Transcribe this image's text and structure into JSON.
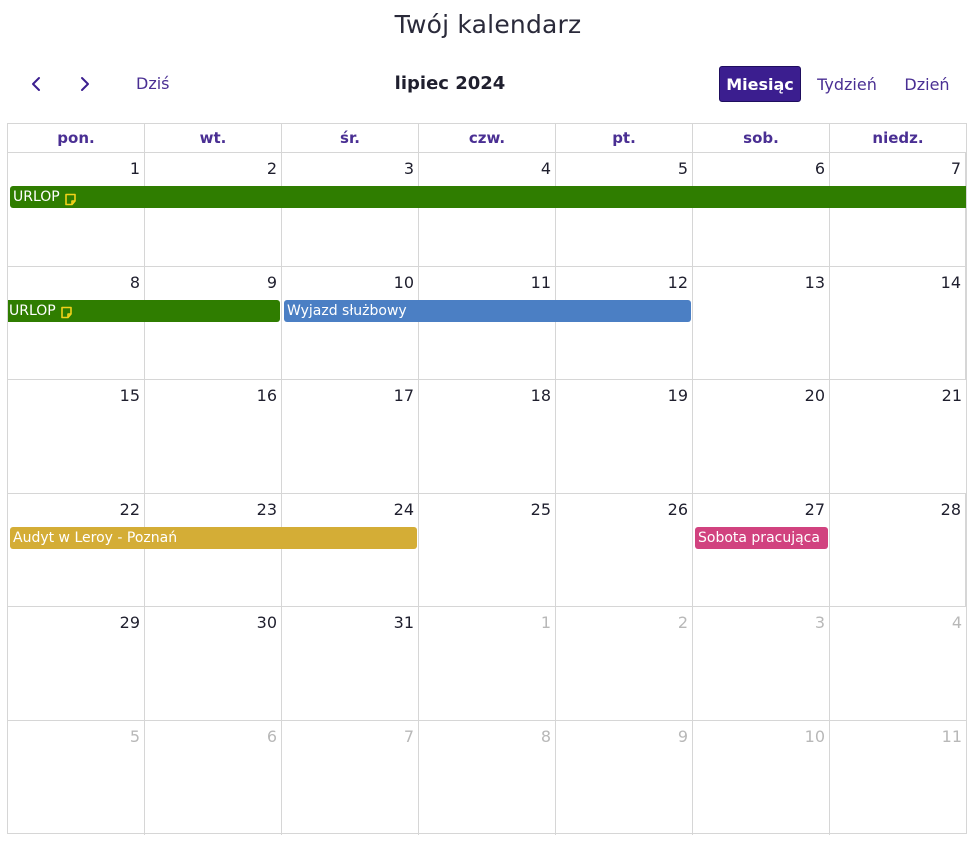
{
  "page": {
    "title": "Twój kalendarz"
  },
  "toolbar": {
    "today_label": "Dziś",
    "period_label": "lipiec 2024",
    "views": {
      "month": "Miesiąc",
      "week": "Tydzień",
      "day": "Dzień"
    },
    "active_view": "month"
  },
  "weekdays": [
    "pon.",
    "wt.",
    "śr.",
    "czw.",
    "pt.",
    "sob.",
    "niedz."
  ],
  "weeks": [
    [
      {
        "n": "1"
      },
      {
        "n": "2"
      },
      {
        "n": "3"
      },
      {
        "n": "4"
      },
      {
        "n": "5"
      },
      {
        "n": "6"
      },
      {
        "n": "7"
      }
    ],
    [
      {
        "n": "8"
      },
      {
        "n": "9"
      },
      {
        "n": "10"
      },
      {
        "n": "11"
      },
      {
        "n": "12"
      },
      {
        "n": "13"
      },
      {
        "n": "14"
      }
    ],
    [
      {
        "n": "15"
      },
      {
        "n": "16"
      },
      {
        "n": "17"
      },
      {
        "n": "18"
      },
      {
        "n": "19"
      },
      {
        "n": "20"
      },
      {
        "n": "21"
      }
    ],
    [
      {
        "n": "22"
      },
      {
        "n": "23"
      },
      {
        "n": "24"
      },
      {
        "n": "25"
      },
      {
        "n": "26"
      },
      {
        "n": "27"
      },
      {
        "n": "28"
      }
    ],
    [
      {
        "n": "29"
      },
      {
        "n": "30"
      },
      {
        "n": "31"
      },
      {
        "n": "1",
        "other": true
      },
      {
        "n": "2",
        "other": true
      },
      {
        "n": "3",
        "other": true
      },
      {
        "n": "4",
        "other": true
      }
    ],
    [
      {
        "n": "5",
        "other": true
      },
      {
        "n": "6",
        "other": true
      },
      {
        "n": "7",
        "other": true
      },
      {
        "n": "8",
        "other": true
      },
      {
        "n": "9",
        "other": true
      },
      {
        "n": "10",
        "other": true
      },
      {
        "n": "11",
        "other": true
      }
    ]
  ],
  "events": [
    {
      "title": "URLOP",
      "week": 0,
      "start": 0,
      "end": 6,
      "color": "#2f7d00",
      "note": true,
      "continues_right": true
    },
    {
      "title": "URLOP",
      "week": 1,
      "start": 0,
      "end": 1,
      "color": "#2f7d00",
      "note": true,
      "continues_left": true
    },
    {
      "title": "Wyjazd służbowy",
      "week": 1,
      "start": 2,
      "end": 4,
      "color": "#4b7fc4"
    },
    {
      "title": "Audyt w Leroy - Poznań",
      "week": 3,
      "start": 0,
      "end": 2,
      "color": "#d4ad36"
    },
    {
      "title": "Sobota pracująca",
      "week": 3,
      "start": 5,
      "end": 5,
      "color": "#d1427f"
    }
  ],
  "colors": {
    "accent": "#3b1e8f",
    "note_icon": "#f2d21a"
  }
}
